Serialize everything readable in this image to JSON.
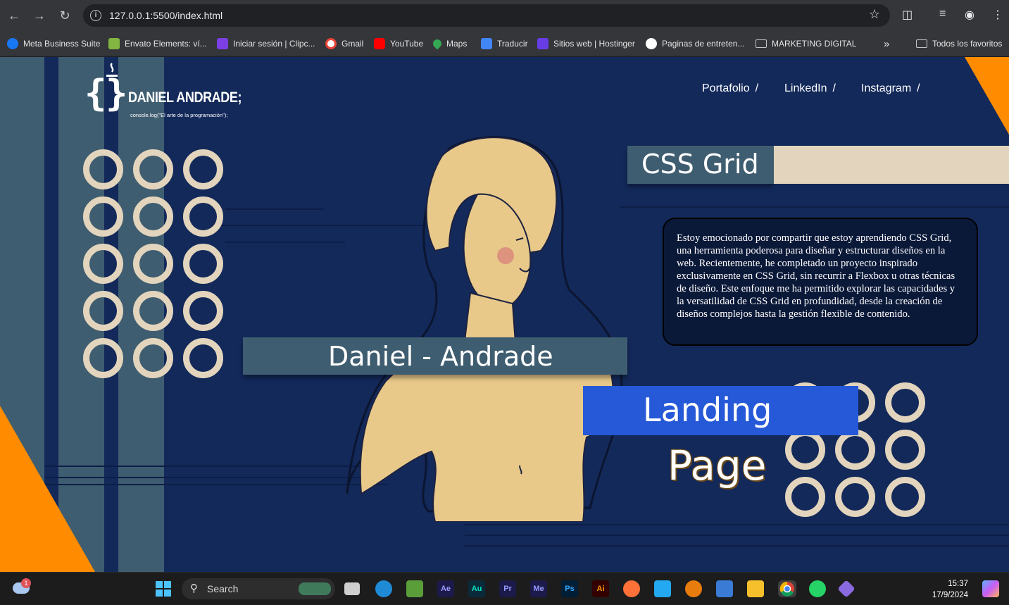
{
  "browser": {
    "url": "127.0.0.1:5500/index.html",
    "bookmarks": [
      {
        "label": "Meta Business Suite",
        "icon": "meta-icon",
        "color": "#1877f2"
      },
      {
        "label": "Envato Elements: ví...",
        "icon": "envato-icon",
        "color": "#82b541"
      },
      {
        "label": "Iniciar sesión | Clipc...",
        "icon": "clipchamp-icon",
        "color": "#7b3fe4"
      },
      {
        "label": "Gmail",
        "icon": "google-icon",
        "color": "#ea4335"
      },
      {
        "label": "YouTube",
        "icon": "youtube-icon",
        "color": "#ff0000"
      },
      {
        "label": "Maps",
        "icon": "maps-icon",
        "color": "#34a853"
      },
      {
        "label": "Traducir",
        "icon": "translate-icon",
        "color": "#4285f4"
      },
      {
        "label": "Sitios web | Hostinger",
        "icon": "hostinger-icon",
        "color": "#673de6"
      },
      {
        "label": "Paginas de entreten...",
        "icon": "openai-icon",
        "color": "#ffffff"
      },
      {
        "label": "MARKETING DIGITAL",
        "icon": "folder-icon",
        "color": "#c6c6c6"
      }
    ],
    "more_label": "»",
    "all_bookmarks": "Todos los favoritos"
  },
  "page": {
    "logo": {
      "title": "DANIEL ANDRADE;",
      "subtitle": "console.log(\"El arte de la programación\");"
    },
    "nav": [
      {
        "label": "Portafolio",
        "sep": "/"
      },
      {
        "label": "LinkedIn",
        "sep": "/"
      },
      {
        "label": "Instagram",
        "sep": "/"
      }
    ],
    "css_grid_title": "CSS Grid",
    "description": "Estoy emocionado por compartir que estoy aprendiendo CSS Grid, una herramienta poderosa para diseñar y estructurar diseños en la web. Recientemente, he completado un proyecto inspirado exclusivamente en CSS Grid, sin recurrir a Flexbox u otras técnicas de diseño. Este enfoque me ha permitido explorar las capacidades y la versatilidad de CSS Grid en profundidad, desde la creación de diseños complejos hasta la gestión flexible de contenido.",
    "name": "Daniel - Andrade",
    "landing": "Landing",
    "page_word": "Page",
    "colors": {
      "background": "#13295a",
      "stripe_light": "#3f5d70",
      "accent_orange": "#ff8c00",
      "cream": "#e3d5bd",
      "statue": "#e8c98a",
      "blue": "#2659d8"
    }
  },
  "taskbar": {
    "weather_badge": "1",
    "search_label": "Search",
    "time": "15:37",
    "date": "17/9/2024",
    "apps": [
      "windows-icon",
      "task-view-icon",
      "edge-icon",
      "minecraft-icon",
      "after-effects-icon",
      "audition-icon",
      "premiere-icon",
      "media-encoder-icon",
      "photoshop-icon",
      "illustrator-icon",
      "firefox-icon",
      "vscode-icon",
      "blender-icon",
      "store-icon",
      "file-explorer-icon",
      "chrome-icon",
      "whatsapp-icon",
      "git-icon",
      "copilot-icon"
    ],
    "app_labels": {
      "ae": "Ae",
      "au": "Au",
      "pr": "Pr",
      "me": "Me",
      "ps": "Ps",
      "ai": "Ai"
    }
  }
}
